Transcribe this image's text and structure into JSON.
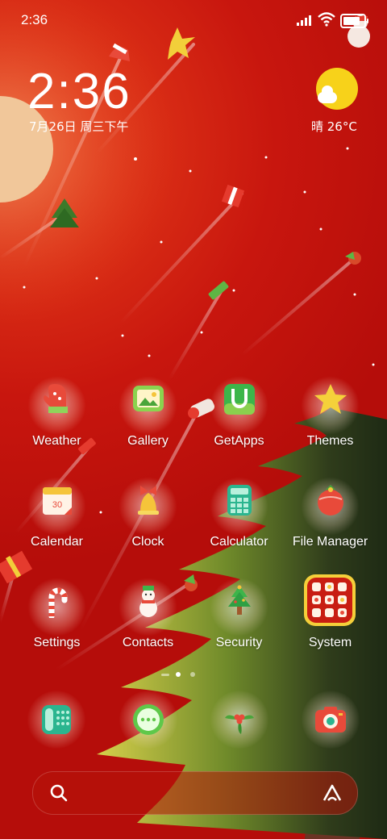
{
  "status_bar": {
    "time": "2:36",
    "battery_level": 0.85
  },
  "lock_clock": {
    "time": "2:36",
    "date": "7月26日 周三下午"
  },
  "weather_widget": {
    "text": "晴 26°C",
    "icon": "sun-cloud-icon"
  },
  "search": {
    "placeholder": "",
    "search_icon": "search-icon",
    "assistant_icon": "assistant-icon"
  },
  "page_indicator": {
    "pages": 3,
    "current": 1
  },
  "apps": [
    {
      "label": "Weather",
      "icon": "mitten-icon"
    },
    {
      "label": "Gallery",
      "icon": "gallery-icon"
    },
    {
      "label": "GetApps",
      "icon": "getapps-icon"
    },
    {
      "label": "Themes",
      "icon": "star-icon"
    },
    {
      "label": "Calendar",
      "icon": "calendar-icon",
      "badge": "30"
    },
    {
      "label": "Clock",
      "icon": "bell-icon"
    },
    {
      "label": "Calculator",
      "icon": "calculator-icon"
    },
    {
      "label": "File Manager",
      "icon": "ornament-icon"
    },
    {
      "label": "Settings",
      "icon": "candy-cane-icon"
    },
    {
      "label": "Contacts",
      "icon": "snowman-icon"
    },
    {
      "label": "Security",
      "icon": "christmas-tree-icon"
    },
    {
      "label": "System",
      "icon": "folder-icon"
    }
  ],
  "dock": [
    {
      "name": "Phone",
      "icon": "phone-icon"
    },
    {
      "name": "Messaging",
      "icon": "message-icon"
    },
    {
      "name": "Browser",
      "icon": "holly-icon"
    },
    {
      "name": "Camera",
      "icon": "camera-icon"
    }
  ],
  "colors": {
    "background": "#c8160e",
    "tree_dark": "#2b3a1c",
    "tree_light": "#b9c23a",
    "sun": "#f7d21a"
  }
}
